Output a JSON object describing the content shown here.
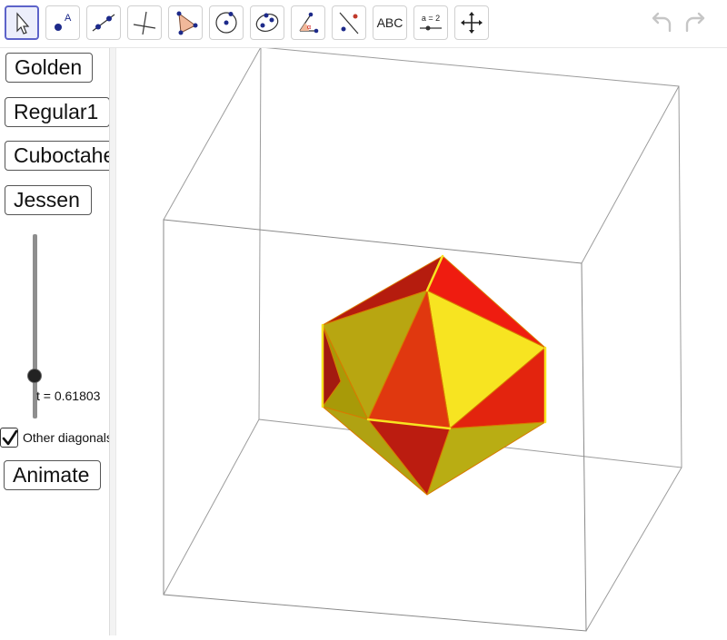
{
  "toolbar": {
    "tools": [
      {
        "name": "move-tool",
        "active": true
      },
      {
        "name": "point-tool"
      },
      {
        "name": "line-tool"
      },
      {
        "name": "perpendicular-line-tool"
      },
      {
        "name": "polygon-tool"
      },
      {
        "name": "circle-tool"
      },
      {
        "name": "conic-tool"
      },
      {
        "name": "angle-tool"
      },
      {
        "name": "reflect-tool"
      },
      {
        "name": "text-tool",
        "label": "ABC"
      },
      {
        "name": "slider-tool",
        "label": "a = 2"
      },
      {
        "name": "move-graphics-view-tool"
      }
    ]
  },
  "panel": {
    "buttons": [
      "Golden",
      "Regular1",
      "Cuboctahedron",
      "Jessen"
    ],
    "slider": {
      "label": "t = 0.61803",
      "value": 0.61803
    },
    "checkbox": {
      "label": "Other diagonals",
      "checked": true
    },
    "animate_label": "Animate"
  },
  "colors": {
    "accent": "#5d63c9",
    "face_red": "#ef1c10",
    "face_yellow": "#f7e421",
    "face_olive": "#a89d0c",
    "face_dark": "#b71a10"
  }
}
